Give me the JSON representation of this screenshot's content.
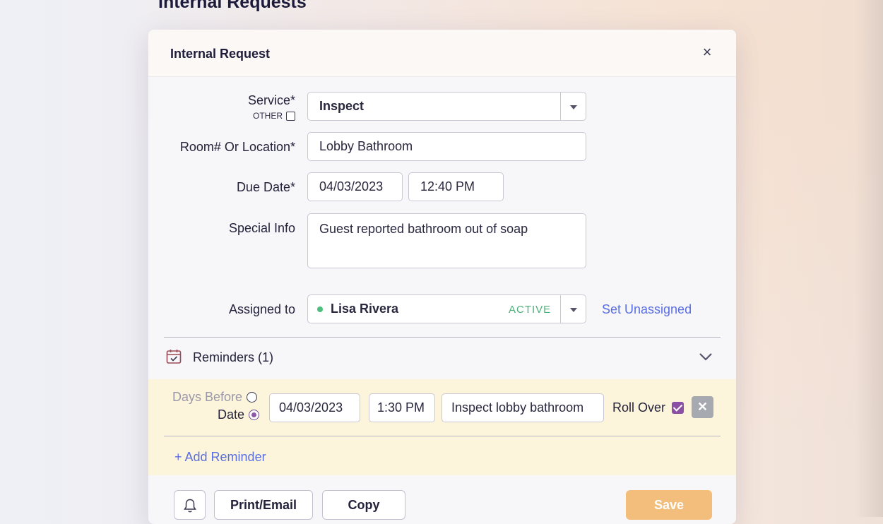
{
  "page": {
    "title": "Internal Requests"
  },
  "dialog": {
    "title": "Internal Request",
    "close_glyph": "×"
  },
  "form": {
    "service": {
      "label": "Service*",
      "value": "Inspect",
      "other_label": "OTHER",
      "other_checked": false
    },
    "location": {
      "label": "Room# Or Location*",
      "value": "Lobby Bathroom"
    },
    "due": {
      "label": "Due Date*",
      "date": "04/03/2023",
      "time": "12:40 PM"
    },
    "special": {
      "label": "Special Info",
      "value": "Guest reported bathroom out of soap"
    },
    "assigned": {
      "label": "Assigned to",
      "value": "Lisa Rivera",
      "status": "ACTIVE",
      "unassign_label": "Set Unassigned"
    }
  },
  "reminders": {
    "title": "Reminders (1)",
    "items": [
      {
        "mode_days_label": "Days Before",
        "mode_date_label": "Date",
        "selected_mode": "date",
        "date": "04/03/2023",
        "time": "1:30 PM",
        "note": "Inspect lobby bathroom",
        "rollover_label": "Roll Over",
        "rollover_checked": true,
        "remove_glyph": "✕"
      }
    ],
    "add_label": "+ Add Reminder"
  },
  "footer": {
    "print_label": "Print/Email",
    "copy_label": "Copy",
    "save_label": "Save"
  },
  "colors": {
    "accent_link": "#5a6fe0",
    "active_green": "#4cb07a",
    "save_orange": "#f3be7c",
    "checkbox_purple": "#8b4fa6",
    "reminder_bg": "#fcf5dc"
  },
  "icons": [
    "close-icon",
    "caret-down-icon",
    "calendar-check-icon",
    "chevron-down-icon",
    "bell-icon"
  ]
}
